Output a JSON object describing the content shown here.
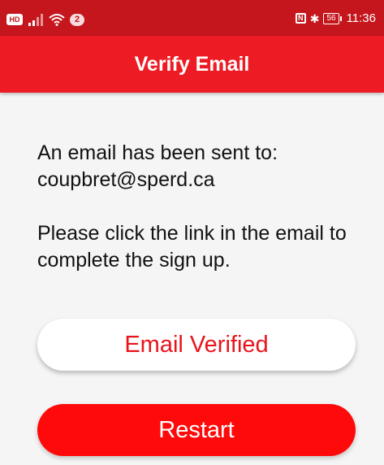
{
  "status_bar": {
    "hd_label": "HD",
    "notification_count": "2",
    "nfc_label": "N",
    "battery_level": "56",
    "time": "11:36"
  },
  "app_bar": {
    "title": "Verify Email"
  },
  "message": {
    "line1": "An email has been sent to:",
    "email": "coupbret@sperd.ca",
    "instructions": "Please click the link in the email to complete the sign up."
  },
  "buttons": {
    "email_verified_label": "Email Verified",
    "restart_label": "Restart"
  },
  "colors": {
    "status_bar": "#c4161c",
    "primary": "#ed1c24",
    "restart_button": "#ff0a0a",
    "background": "#f5f5f5"
  },
  "icons": [
    "hd-icon",
    "signal-icon",
    "wifi-icon",
    "nfc-icon",
    "bluetooth-icon",
    "battery-icon"
  ]
}
